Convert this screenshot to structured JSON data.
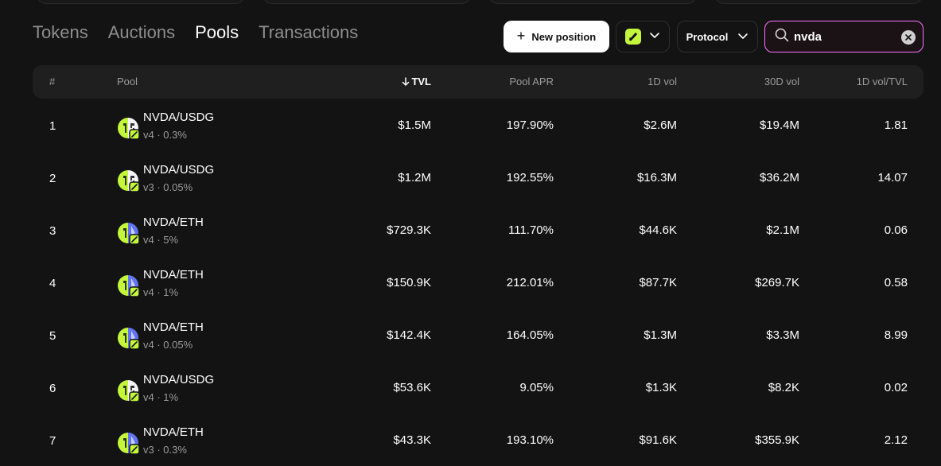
{
  "nav": {
    "tabs": [
      {
        "label": "Tokens",
        "active": false
      },
      {
        "label": "Auctions",
        "active": false
      },
      {
        "label": "Pools",
        "active": true
      },
      {
        "label": "Transactions",
        "active": false
      }
    ]
  },
  "controls": {
    "new_position_label": "New position",
    "protocol_label": "Protocol",
    "search_value": "nvda"
  },
  "table": {
    "columns": [
      "#",
      "Pool",
      "TVL",
      "Pool APR",
      "1D vol",
      "30D vol",
      "1D vol/TVL"
    ],
    "sort_column": "TVL",
    "sort_direction": "desc",
    "rows": [
      {
        "rank": "1",
        "pair": "NVDA/USDG",
        "meta": "v4 · 0.3%",
        "tvl": "$1.5M",
        "apr": "197.90%",
        "vol1d": "$2.6M",
        "vol30d": "$19.4M",
        "ratio": "1.81",
        "quote": "usdg"
      },
      {
        "rank": "2",
        "pair": "NVDA/USDG",
        "meta": "v3 · 0.05%",
        "tvl": "$1.2M",
        "apr": "192.55%",
        "vol1d": "$16.3M",
        "vol30d": "$36.2M",
        "ratio": "14.07",
        "quote": "usdg"
      },
      {
        "rank": "3",
        "pair": "NVDA/ETH",
        "meta": "v4 · 5%",
        "tvl": "$729.3K",
        "apr": "111.70%",
        "vol1d": "$44.6K",
        "vol30d": "$2.1M",
        "ratio": "0.06",
        "quote": "eth"
      },
      {
        "rank": "4",
        "pair": "NVDA/ETH",
        "meta": "v4 · 1%",
        "tvl": "$150.9K",
        "apr": "212.01%",
        "vol1d": "$87.7K",
        "vol30d": "$269.7K",
        "ratio": "0.58",
        "quote": "eth"
      },
      {
        "rank": "5",
        "pair": "NVDA/ETH",
        "meta": "v4 · 0.05%",
        "tvl": "$142.4K",
        "apr": "164.05%",
        "vol1d": "$1.3M",
        "vol30d": "$3.3M",
        "ratio": "8.99",
        "quote": "eth"
      },
      {
        "rank": "6",
        "pair": "NVDA/USDG",
        "meta": "v4 · 1%",
        "tvl": "$53.6K",
        "apr": "9.05%",
        "vol1d": "$1.3K",
        "vol30d": "$8.2K",
        "ratio": "0.02",
        "quote": "usdg"
      },
      {
        "rank": "7",
        "pair": "NVDA/ETH",
        "meta": "v3 · 0.3%",
        "tvl": "$43.3K",
        "apr": "193.10%",
        "vol1d": "$91.6K",
        "vol30d": "$355.9K",
        "ratio": "2.12",
        "quote": "eth"
      }
    ]
  },
  "colors": {
    "background": "#131313",
    "accent_pink": "#fc72ff",
    "chain_green": "#c4f73c",
    "eth_blue": "#6274ee",
    "muted_text": "#9b9b9b"
  },
  "icons": {
    "new_position": "plus-icon",
    "network": "chain-logo-icon",
    "dropdown": "chevron-down-icon",
    "search": "search-icon",
    "clear": "close-icon",
    "sort": "arrow-down-icon"
  }
}
